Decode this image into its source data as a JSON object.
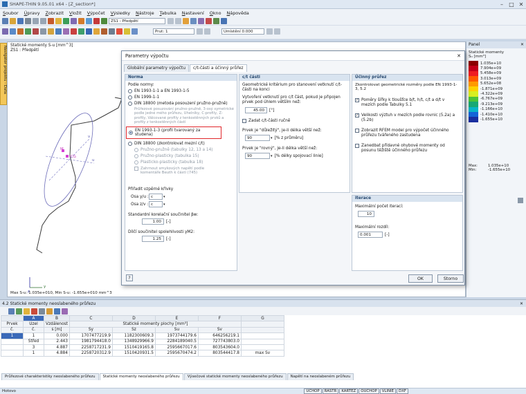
{
  "window": {
    "title": "SHAPE-THIN 9.05.01 x64 - [Z_section*]"
  },
  "menu": [
    "Soubor",
    "Úpravy",
    "Zobrazit",
    "Vložit",
    "Výpočet",
    "Výsledky",
    "Nástroje",
    "Tabulka",
    "Nastavení",
    "Okno",
    "Nápověda"
  ],
  "toolbar": {
    "zs_combo": "ZS1 - Předpětí",
    "prut_combo": "Prut: 1",
    "umisteni_combo": "Umístění 0.000"
  },
  "sidetab": "Navigátor projektu - Data",
  "canvas": {
    "title_line1": "Statické momenty S-u [mm^3]",
    "title_line2": "ZS1 : Předpětí",
    "max_min": "Max S-u: 1.035e+010, Min S-u: -1.655e+010 mm^3",
    "labels": {
      "y": "y",
      "z": "z",
      "m": "M",
      "cg": "CG",
      "u": "u",
      "v": "v"
    }
  },
  "panel": {
    "title": "Panel",
    "subtitle": "Statické momenty",
    "unit": "Sᵤ [mm³]",
    "legend": [
      {
        "v": "1.035e+10",
        "c": "#8b0000"
      },
      {
        "v": "7.904e+09",
        "c": "#c4001a"
      },
      {
        "v": "5.458e+09",
        "c": "#ee1d23"
      },
      {
        "v": "3.013e+09",
        "c": "#ff5a00"
      },
      {
        "v": "5.652e+08",
        "c": "#ff9a00"
      },
      {
        "v": "-1.871e+09",
        "c": "#ffd200"
      },
      {
        "v": "-4.322e+09",
        "c": "#d8ef21"
      },
      {
        "v": "-6.767e+09",
        "c": "#4cc338"
      },
      {
        "v": "-9.213e+09",
        "c": "#19a874"
      },
      {
        "v": "-1.166e+10",
        "c": "#0ab5c8"
      },
      {
        "v": "-1.410e+10",
        "c": "#1565d8"
      },
      {
        "v": "-1.655e+10",
        "c": "#1a2fa0"
      }
    ],
    "max_label": "Max:",
    "max_val": "1.035e+10",
    "min_label": "Min:",
    "min_val": "-1.655e+10"
  },
  "dialog": {
    "title": "Parametry výpočtu",
    "close": "✕",
    "tabs": [
      "Globální parametry výpočtu",
      "c/t-části a účinný průřez"
    ],
    "norma": {
      "head": "Norma",
      "podle": "Podle normy:",
      "options": [
        "EN 1993-1-1 a EN 1993-1-5",
        "EN 1999-1-1",
        "DIN 18800 (metoda posouzení pružno-pružně)",
        "EN 1993-1-3 (profil tvarovaný za studena)",
        "DIN 18800 (zkontrolovat mezní c/t)"
      ],
      "din_note": "Průřezové posuzování pružno-pružně, 3-osý symetrické podle jedné mého průřezu, Uhelníky, C-profily, Z-profily, Válcované profily z tenkostěnných prvků a profily z tenkostěnných částí",
      "sub": [
        "Pružno-pružně (tabulky 12, 13 a 14)",
        "Pružno-plasticky (tabulka 15)",
        "Plasticko-plasticky (tabulka 18)"
      ],
      "zahrnout": "Zahrnout smykových napětí podle komentáře Beuth k části (745)",
      "krivky": "Přiřadit vzpěrné křivky",
      "osa_y": "Osa y/u :",
      "osa_y_val": "c",
      "osa_z": "Osa z/v :",
      "osa_z_val": "c",
      "bw_label": "Standardní korelační součinitel βw:",
      "bw_val": "1.00",
      "gm_label": "Dílčí součinitel spolehlivosti γM2:",
      "gm_val": "1.25",
      "unit_dash": "[-]"
    },
    "ct": {
      "head": "c/t části",
      "desc": "Geometrické kritérium pro stanovení vetknutí c/t-části na konci",
      "vytvor": "Vytvoření vetknutí pro c/t část, pokud je připojen prvek pod úhlem větším než:",
      "angle_val": "45.00",
      "angle_unit": "[°]",
      "zadat": "Zadat c/t-části ručně",
      "prvek_dul": "Prvek je \"důležitý\", je-li délka větší než:",
      "dul_val": "90",
      "dul_unit": "[% z průměru]",
      "prvek_rov": "Prvek je \"rovný\", je-li délka větší než:",
      "rov_val": "90",
      "rov_unit": "[% délky spojovací linie]"
    },
    "ucinny": {
      "head": "Účinný průřez",
      "desc": "Zkontrolovat geometrické rozměry podle EN 1993-1-3, 5.2",
      "c1": "Poměry šířky k tloušťce b/t, h/t, c/t a d/t v mezích podle Tabulky 5.1",
      "c2": "Velikosti výztuh v mezích podle rovnic (5.2a) a (5.2b)",
      "c3": "Zobrazit RFEM model pro výpočet účinného průřezu tvářeného zastudena",
      "c4": "Zanedbat přídavné ohybové momenty od posunu těžiště účinného průřezu"
    },
    "iterace": {
      "head": "Iterace",
      "max_label": "Maximální počet iterací:",
      "max_val": "10",
      "rozdil_label": "Maximální rozdíl:",
      "rozdil_val": "0.001",
      "rozdil_unit": "[-]"
    },
    "ok": "OK",
    "storno": "Storno"
  },
  "table": {
    "caption": "4.2 Statické momenty neoslabeného průřezu",
    "col_letters": [
      "A",
      "B",
      "C",
      "D",
      "E",
      "F",
      "G"
    ],
    "head1": [
      "Prvek",
      "Uzel",
      "Vzdálenost",
      "Statické momenty plochy [mm³]"
    ],
    "head2": [
      "č.",
      "č.",
      "s [m]",
      "Sy",
      "Sz",
      "Su",
      "Sv"
    ],
    "rows": [
      [
        "1",
        "1",
        "0.000",
        "1707477219.9",
        "1182300609.3",
        "1973744179.6",
        "646256219.1",
        ""
      ],
      [
        "",
        "Střed",
        "2.443",
        "1981794418.0",
        "1348929966.9",
        "2284189040.5",
        "727743803.0",
        ""
      ],
      [
        "",
        "3",
        "4.887",
        "2258717231.9",
        "1510419165.8",
        "2595667017.6",
        "803543604.0",
        ""
      ],
      [
        "",
        "1",
        "4.884",
        "2258720312.9",
        "1510420931.5",
        "2595670474.2",
        "803544417.8",
        "max Sv"
      ]
    ],
    "tabs": [
      "Průřezové charakteristiky neoslabeného průřezu",
      "Statické momenty neoslabeného průřezu",
      "Výsečové statické momenty neoslabeného průřezu",
      "Napětí na neoslabeném průřezu"
    ]
  },
  "status": {
    "text": "Hotovo",
    "buttons": [
      "UCHOP",
      "RASTR",
      "KARTEZ",
      "OUCHOP",
      "VLINIE",
      "DXF"
    ]
  }
}
